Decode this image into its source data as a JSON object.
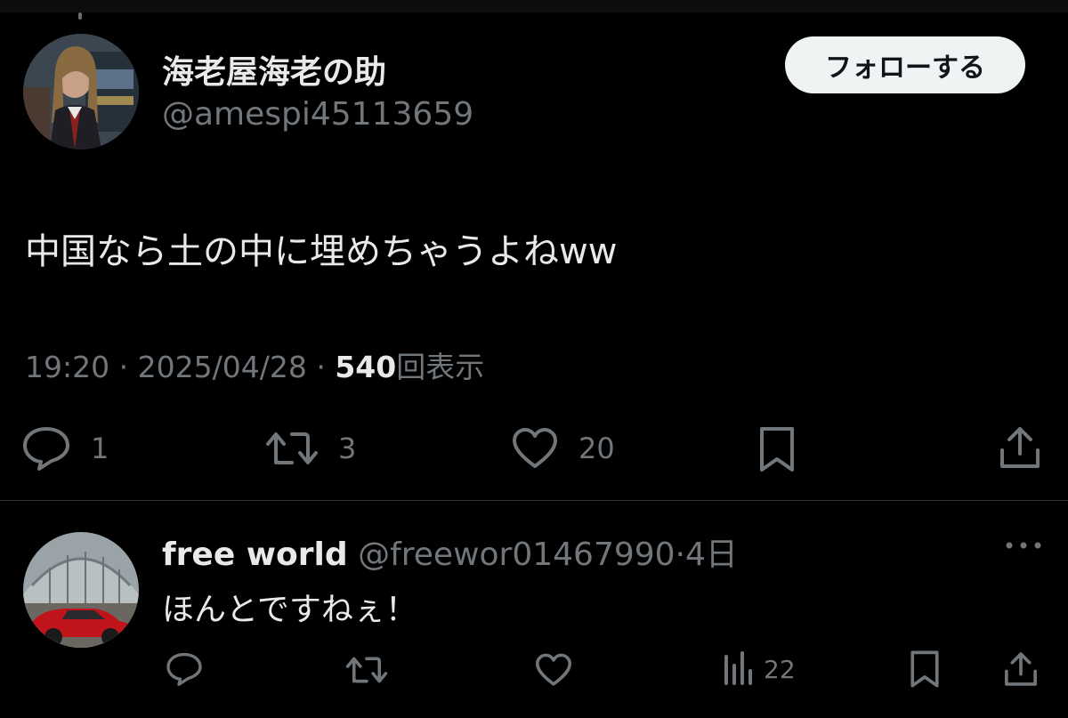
{
  "tweet": {
    "author": {
      "display_name": "海老屋海老の助",
      "handle": "@amespi45113659",
      "avatar": "profile-photo"
    },
    "follow_label": "フォローする",
    "text": "中国なら土の中に埋めちゃうよねww",
    "time": "19:20",
    "separator": "·",
    "date": "2025/04/28",
    "views_count": "540",
    "views_label": "回表示",
    "actions": {
      "reply": {
        "icon": "reply-icon",
        "count": "1"
      },
      "retweet": {
        "icon": "retweet-icon",
        "count": "3"
      },
      "like": {
        "icon": "heart-icon",
        "count": "20"
      },
      "bookmark": {
        "icon": "bookmark-icon"
      },
      "share": {
        "icon": "share-icon"
      }
    }
  },
  "reply": {
    "display_name": "free world",
    "handle": "@freewor01467990",
    "separator": "·",
    "time_ago": "4日",
    "text": "ほんとですねぇ！",
    "avatar": "profile-photo",
    "more_icon": "more-icon",
    "actions": {
      "reply": {
        "icon": "reply-icon"
      },
      "retweet": {
        "icon": "retweet-icon"
      },
      "like": {
        "icon": "heart-icon"
      },
      "views": {
        "icon": "views-icon",
        "count": "22"
      },
      "bookmark": {
        "icon": "bookmark-icon"
      },
      "share": {
        "icon": "share-icon"
      }
    }
  },
  "colors": {
    "background": "#000000",
    "primary_text": "#e7e9ea",
    "secondary_text": "#71767b",
    "follow_button_bg": "#eff3f4",
    "divider": "#2f3336"
  }
}
